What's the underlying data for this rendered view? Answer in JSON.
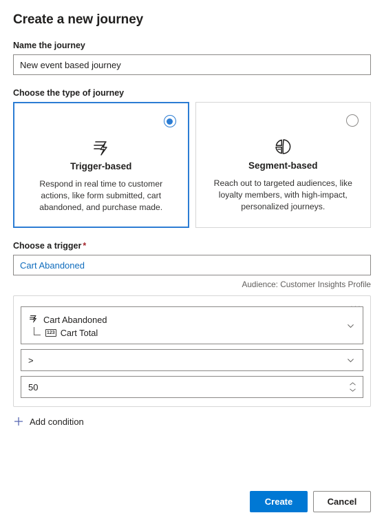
{
  "dialog": {
    "title": "Create a new journey"
  },
  "name_field": {
    "label": "Name the journey",
    "value": "New event based journey",
    "placeholder": "Name the journey"
  },
  "journey_type": {
    "label": "Choose the type of journey",
    "options": [
      {
        "key": "trigger-based",
        "title": "Trigger-based",
        "description": "Respond in real time to customer actions, like form submitted, cart abandoned, and purchase made.",
        "icon": "trigger-lightning-icon",
        "selected": true
      },
      {
        "key": "segment-based",
        "title": "Segment-based",
        "description": "Reach out to targeted audiences, like loyalty members, with high-impact, personalized journeys.",
        "icon": "pie-chart-icon",
        "selected": false
      }
    ]
  },
  "trigger_field": {
    "label": "Choose a trigger",
    "required_marker": "*",
    "value": "Cart Abandoned",
    "placeholder": "Choose a trigger",
    "audience_hint": "Audience: Customer Insights Profile"
  },
  "condition_panel": {
    "overflow_menu_label": "···",
    "attribute_row": {
      "trigger_name": "Cart Abandoned",
      "trigger_icon": "trigger-lightning-icon",
      "attribute_name": "Cart Total",
      "attribute_type_badge": "123",
      "chevron": "chevron-down-icon"
    },
    "operator_row": {
      "value": ">",
      "chevron": "chevron-down-icon"
    },
    "value_row": {
      "value": "50",
      "spinner": "up-down-spinner"
    }
  },
  "add_condition": {
    "label": "Add condition",
    "icon": "plus-icon"
  },
  "footer": {
    "create_label": "Create",
    "cancel_label": "Cancel"
  },
  "colors": {
    "accent": "#0078d4",
    "selected_border": "#2b7cd3",
    "link": "#0f6cbd",
    "required": "#a4262c",
    "muted_text": "#605e5c",
    "border": "#8a8886",
    "panel_border": "#d6d6d6",
    "plus": "#5b6ab4"
  }
}
